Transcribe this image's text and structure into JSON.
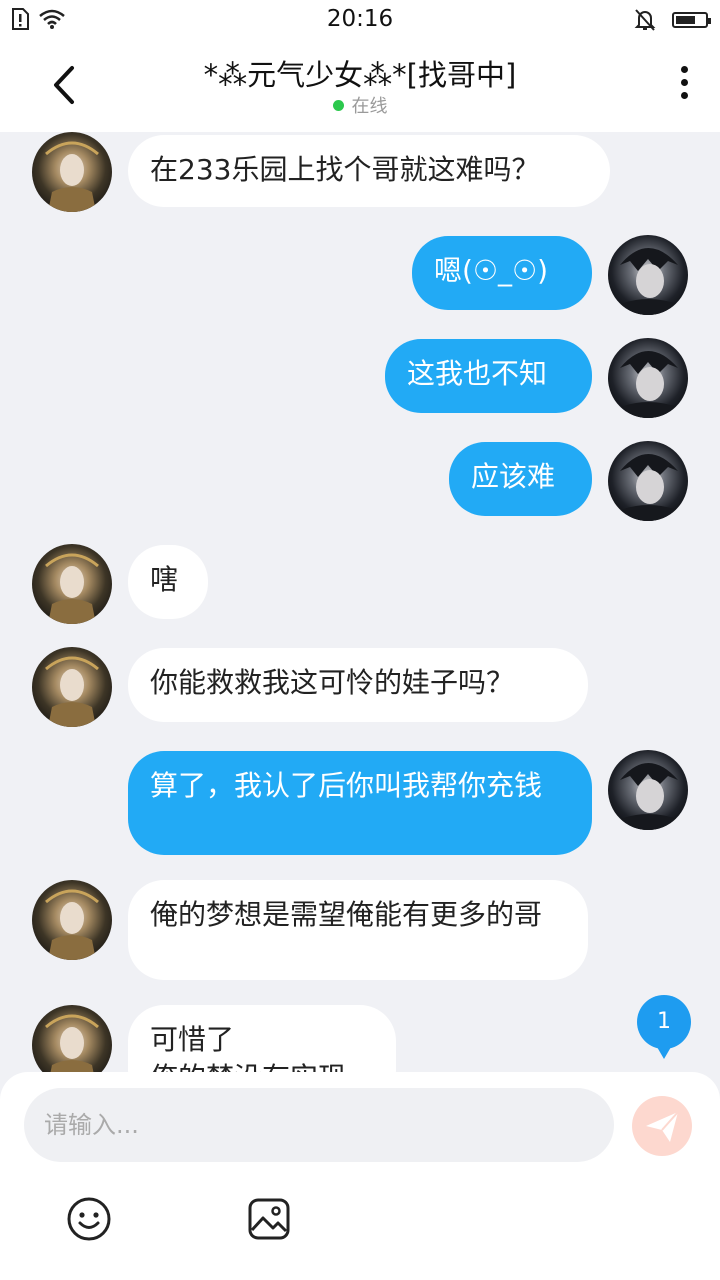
{
  "status_bar": {
    "time": "20:16"
  },
  "header": {
    "title": "*⁂元气少女⁂*[找哥中]",
    "status": "在线"
  },
  "messages": [
    {
      "side": "in",
      "text": "在233乐园上找个哥就这难吗？"
    },
    {
      "side": "out",
      "text": "嗯(☉_☉)"
    },
    {
      "side": "out",
      "text": "这我也不知"
    },
    {
      "side": "out",
      "text": "应该难"
    },
    {
      "side": "in",
      "text": "嗐"
    },
    {
      "side": "in",
      "text": "你能救救我这可怜的娃子吗？"
    },
    {
      "side": "out",
      "text": "算了，我认了后你叫我帮你充钱"
    },
    {
      "side": "in",
      "text": "俺的梦想是需望俺能有更多的哥"
    },
    {
      "side": "in",
      "text": "可惜了\n俺的梦没有实现"
    }
  ],
  "unread_count": "1",
  "composer": {
    "placeholder": "请输入...",
    "value": ""
  },
  "icons": {
    "back": "chevron-left-icon",
    "more": "more-vertical-icon",
    "send": "send-icon",
    "emoji": "smiley-icon",
    "image": "image-icon"
  },
  "colors": {
    "outgoing_bubble": "#22aaf5",
    "incoming_bubble": "#ffffff",
    "background": "#f0f1f5",
    "online_dot": "#2cc84d",
    "unread_badge": "#1e9cf0",
    "send_button": "#fdd8cf"
  }
}
